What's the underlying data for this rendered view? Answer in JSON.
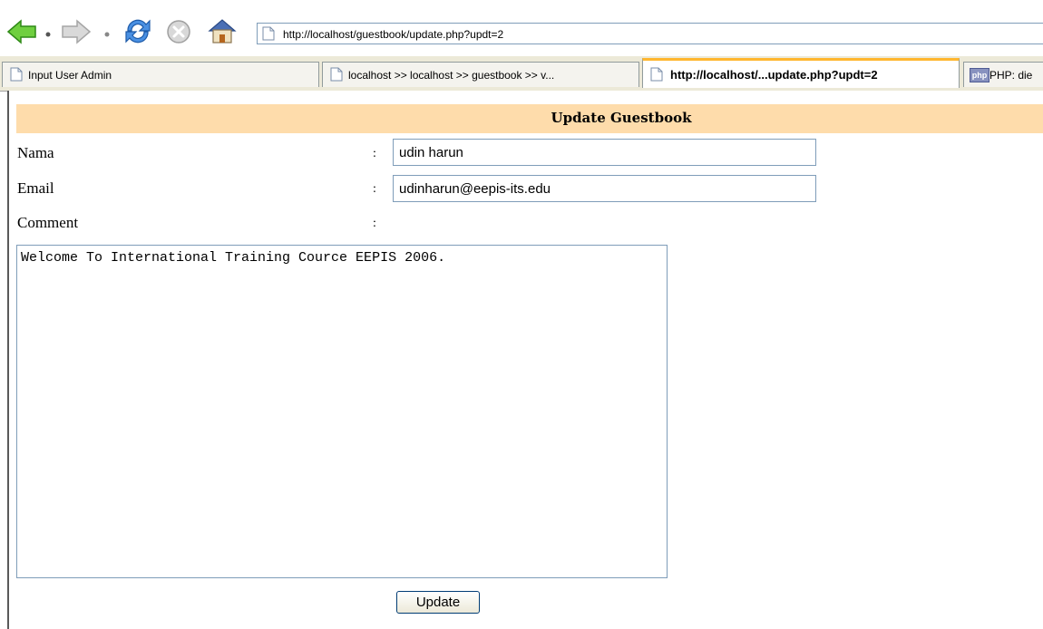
{
  "browser": {
    "toolbar": {
      "icons": [
        "back-icon",
        "forward-icon",
        "refresh-icon",
        "stop-icon",
        "home-icon"
      ],
      "url": "http://localhost/guestbook/update.php?updt=2"
    },
    "tabs": [
      {
        "label": "Input User Admin",
        "active": false,
        "icon": "page-icon"
      },
      {
        "label": "localhost >> localhost >> guestbook >> v...",
        "active": false,
        "icon": "page-icon"
      },
      {
        "label": "http://localhost/...update.php?updt=2",
        "active": true,
        "icon": "page-icon"
      },
      {
        "label": "PHP: die",
        "active": false,
        "icon": "php-icon",
        "icon_text": "php"
      }
    ]
  },
  "page": {
    "title": "Update Guestbook",
    "header_color": "#fedcab",
    "form": {
      "nama_label": "Nama",
      "nama_value": "udin harun",
      "email_label": "Email",
      "email_value": "udinharun@eepis-its.edu",
      "comment_label": "Comment",
      "comment_value": "Welcome To International Training Cource EEPIS 2006.",
      "separator": ":",
      "submit_label": "Update"
    }
  }
}
